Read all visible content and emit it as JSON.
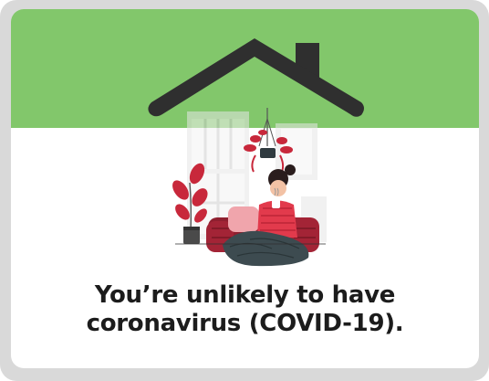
{
  "message": {
    "line1": "You’re unlikely to have",
    "line2": "coronavirus (COVID-19)."
  },
  "colors": {
    "banner": "#82c76b",
    "frame": "#d9d9d9",
    "roof": "#2f2f2f",
    "accent": "#c8283b"
  },
  "icons": {
    "roof": "house-roof-icon",
    "illustration": "woman-resting-at-home-illustration"
  }
}
